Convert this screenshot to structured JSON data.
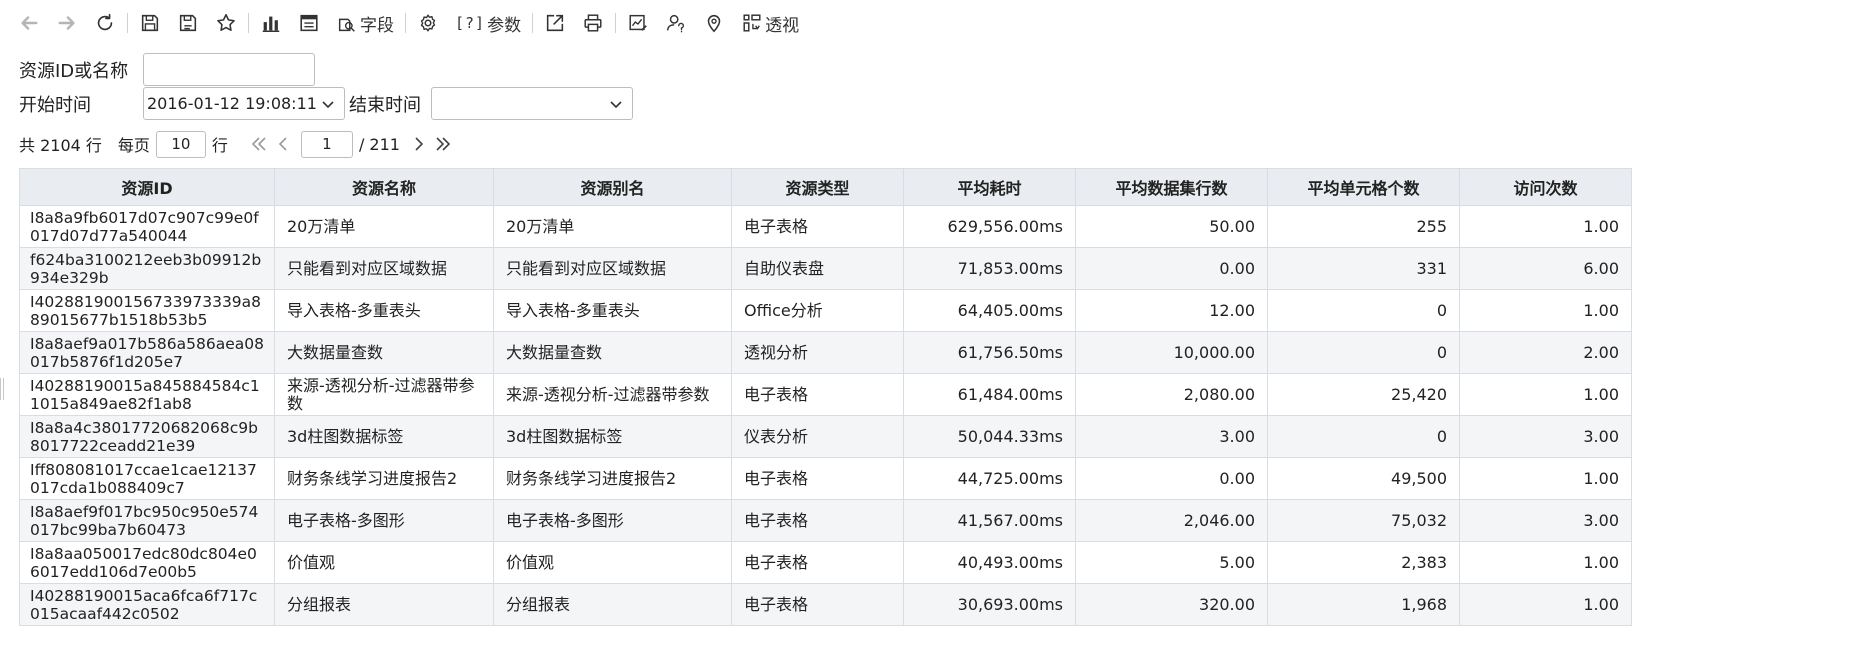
{
  "toolbar": {
    "items": [
      {
        "name": "back-icon",
        "label": ""
      },
      {
        "name": "forward-icon",
        "label": ""
      },
      {
        "name": "refresh-icon",
        "label": ""
      },
      {
        "name": "save-icon",
        "label": ""
      },
      {
        "name": "save-as-icon",
        "label": ""
      },
      {
        "name": "favorite-star-icon",
        "label": ""
      },
      {
        "name": "bar-chart-icon",
        "label": ""
      },
      {
        "name": "table-view-icon",
        "label": ""
      },
      {
        "name": "fields-icon",
        "label": "字段"
      },
      {
        "name": "settings-gear-icon",
        "label": ""
      },
      {
        "name": "parameters-icon",
        "label": "参数",
        "glyph": "[?]"
      },
      {
        "name": "export-icon",
        "label": ""
      },
      {
        "name": "print-icon",
        "label": ""
      },
      {
        "name": "chart-edit-icon",
        "label": ""
      },
      {
        "name": "user-query-icon",
        "label": ""
      },
      {
        "name": "location-pin-icon",
        "label": ""
      },
      {
        "name": "pivot-icon",
        "label": "透视"
      }
    ]
  },
  "filters": {
    "resource_label": "资源ID或名称",
    "resource_value": "",
    "start_label": "开始时间",
    "start_value": "2016-01-12 19:08:11",
    "end_label": "结束时间",
    "end_value": ""
  },
  "pager": {
    "total_text": "共 2104 行",
    "per_page_label": "每页",
    "per_page_value": "10",
    "rows_unit": "行",
    "current_page": "1",
    "total_pages_text": "/ 211"
  },
  "table": {
    "columns": [
      "资源ID",
      "资源名称",
      "资源别名",
      "资源类型",
      "平均耗时",
      "平均数据集行数",
      "平均单元格个数",
      "访问次数"
    ],
    "rows": [
      [
        "I8a8a9fb6017d07c907c99e0f017d07d77a540044",
        "20万清单",
        "20万清单",
        "电子表格",
        "629,556.00ms",
        "50.00",
        "255",
        "1.00"
      ],
      [
        "f624ba3100212eeb3b09912b934e329b",
        "只能看到对应区域数据",
        "只能看到对应区域数据",
        "自助仪表盘",
        "71,853.00ms",
        "0.00",
        "331",
        "6.00"
      ],
      [
        "I402881900156733973339a889015677b1518b53b5",
        "导入表格-多重表头",
        "导入表格-多重表头",
        "Office分析",
        "64,405.00ms",
        "12.00",
        "0",
        "1.00"
      ],
      [
        "I8a8aef9a017b586a586aea08017b5876f1d205e7",
        "大数据量查数",
        "大数据量查数",
        "透视分析",
        "61,756.50ms",
        "10,000.00",
        "0",
        "2.00"
      ],
      [
        "I40288190015a845884584c11015a849ae82f1ab8",
        "来源-透视分析-过滤器带参数",
        "来源-透视分析-过滤器带参数",
        "电子表格",
        "61,484.00ms",
        "2,080.00",
        "25,420",
        "1.00"
      ],
      [
        "I8a8a4c38017720682068c9b8017722ceadd21e39",
        "3d柱图数据标签",
        "3d柱图数据标签",
        "仪表分析",
        "50,044.33ms",
        "3.00",
        "0",
        "3.00"
      ],
      [
        "Iff808081017ccae1cae12137017cda1b088409c7",
        "财务条线学习进度报告2",
        "财务条线学习进度报告2",
        "电子表格",
        "44,725.00ms",
        "0.00",
        "49,500",
        "1.00"
      ],
      [
        "I8a8aef9f017bc950c950e574017bc99ba7b60473",
        "电子表格-多图形",
        "电子表格-多图形",
        "电子表格",
        "41,567.00ms",
        "2,046.00",
        "75,032",
        "3.00"
      ],
      [
        "I8a8aa050017edc80dc804e06017edd106d7e00b5",
        "价值观",
        "价值观",
        "电子表格",
        "40,493.00ms",
        "5.00",
        "2,383",
        "1.00"
      ],
      [
        "I40288190015aca6fca6f717c015acaaf442c0502",
        "分组报表",
        "分组报表",
        "电子表格",
        "30,693.00ms",
        "320.00",
        "1,968",
        "1.00"
      ]
    ]
  }
}
